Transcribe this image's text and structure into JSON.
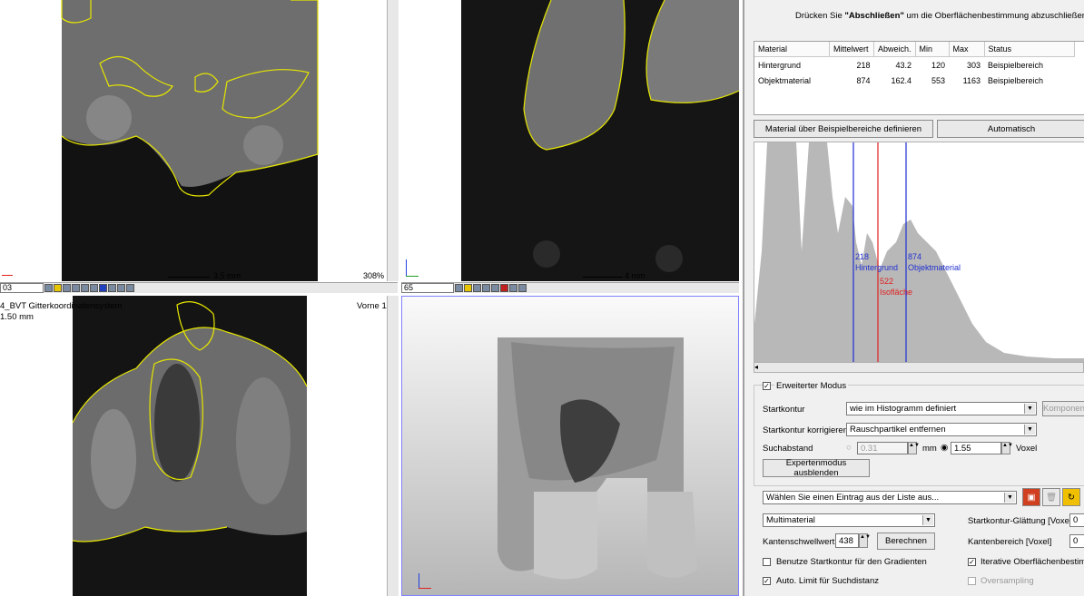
{
  "panel": {
    "instruction_prefix": "Drücken Sie ",
    "instruction_bold": "\"Abschließen\"",
    "instruction_suffix": " um die Oberflächenbestimmung abzuschließen.",
    "table": {
      "headers": [
        "Material",
        "Mittelwert",
        "Abweich.",
        "Min",
        "Max",
        "Status"
      ],
      "rows": [
        [
          "Hintergrund",
          "218",
          "43.2",
          "120",
          "303",
          "Beispielbereich"
        ],
        [
          "Objektmaterial",
          "874",
          "162.4",
          "553",
          "1163",
          "Beispielbereich"
        ]
      ]
    },
    "btn_define": "Material über Beispielbereiche definieren",
    "btn_auto": "Automatisch",
    "histogram": {
      "bg_value": "218",
      "bg_label": "Hintergrund",
      "obj_value": "874",
      "obj_label": "Objektmaterial",
      "iso_value": "522",
      "iso_label": "Isofläche",
      "bg_color": "#2030d0",
      "iso_color": "#e02020"
    },
    "expert_mode_label": "Erweiterter Modus",
    "startkontur_label": "Startkontur",
    "startkontur_value": "wie im Histogramm definiert",
    "komponenten_label": "Komponen",
    "korrigieren_label": "Startkontur korrigieren",
    "korrigieren_value": "Rauschpartikel entfernen",
    "suchabstand_label": "Suchabstand",
    "suchabstand_mm_value": "0.31",
    "mm_unit": "mm",
    "suchabstand_voxel_value": "1.55",
    "voxel_unit": "Voxel",
    "expert_hide_btn": "Expertenmodus ausblenden",
    "list_select_value": "Wählen Sie einen Eintrag aus der Liste aus...",
    "material_mode_value": "Multimaterial",
    "glaettung_label": "Startkontur-Glättung [Voxel]",
    "glaettung_value": "0",
    "kantenschwell_label": "Kantenschwellwert",
    "kantenschwell_value": "438",
    "berechnen_btn": "Berechnen",
    "kantenbereich_label": "Kantenbereich [Voxel]",
    "kantenbereich_value": "0",
    "gradient_label": "Benutze Startkontur für den Gradienten",
    "iterative_label": "Iterative Oberflächenbestimmu",
    "auto_limit_label": "Auto. Limit für Suchdistanz",
    "oversampling_label": "Oversampling"
  },
  "viewports": {
    "tl_scale": "3.5 mm",
    "tl_slice": "03",
    "tl_zoom": "308%",
    "tr_scale": "4 mm",
    "tr_slice": "65",
    "bl_coord_text": "4_BVT Gitterkoordinatensystem",
    "bl_thickness": "1.50 mm",
    "bl_view_label": "Vorne 1"
  },
  "colors": {
    "contour": "#e6e600",
    "axis_x": "#e02020",
    "axis_y": "#20a020",
    "axis_z": "#2040e0",
    "histogram_fill": "#b8b8b8",
    "active_border": "#8080ff"
  }
}
